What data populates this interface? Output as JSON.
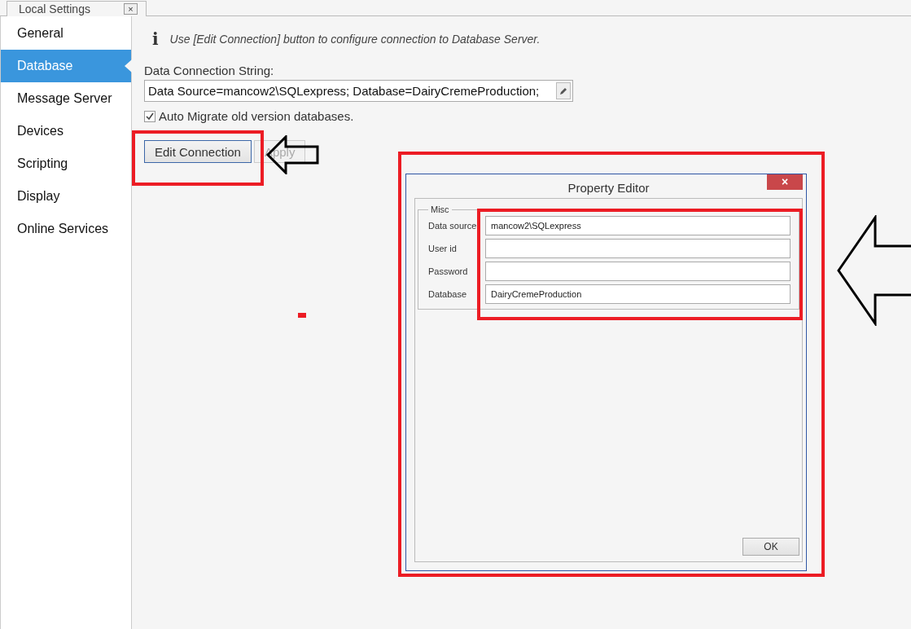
{
  "tab": {
    "title": "Local Settings",
    "close": "×"
  },
  "sidebar": {
    "items": [
      {
        "label": "General",
        "selected": false
      },
      {
        "label": "Database",
        "selected": true
      },
      {
        "label": "Message Server",
        "selected": false
      },
      {
        "label": "Devices",
        "selected": false
      },
      {
        "label": "Scripting",
        "selected": false
      },
      {
        "label": "Display",
        "selected": false
      },
      {
        "label": "Online Services",
        "selected": false
      }
    ]
  },
  "info": {
    "icon": "i",
    "text": "Use [Edit Connection] button to configure connection to Database Server."
  },
  "connection": {
    "label": "Data Connection String:",
    "value": "Data Source=mancow2\\SQLexpress; Database=DairyCremeProduction;"
  },
  "auto_migrate": {
    "label": "Auto Migrate old version databases.",
    "checked": true
  },
  "buttons": [
    {
      "label": "Edit Connection",
      "disabled": false
    },
    {
      "label": "Apply",
      "disabled": true
    }
  ],
  "dialog": {
    "title": "Property Editor",
    "close": "×",
    "group": "Misc",
    "fields": [
      {
        "label": "Data source",
        "value": "mancow2\\SQLexpress"
      },
      {
        "label": "User id"
      },
      {
        "label": "Password"
      },
      {
        "label": "Database",
        "value": "DairyCremeProduction"
      }
    ],
    "ok": "OK"
  }
}
